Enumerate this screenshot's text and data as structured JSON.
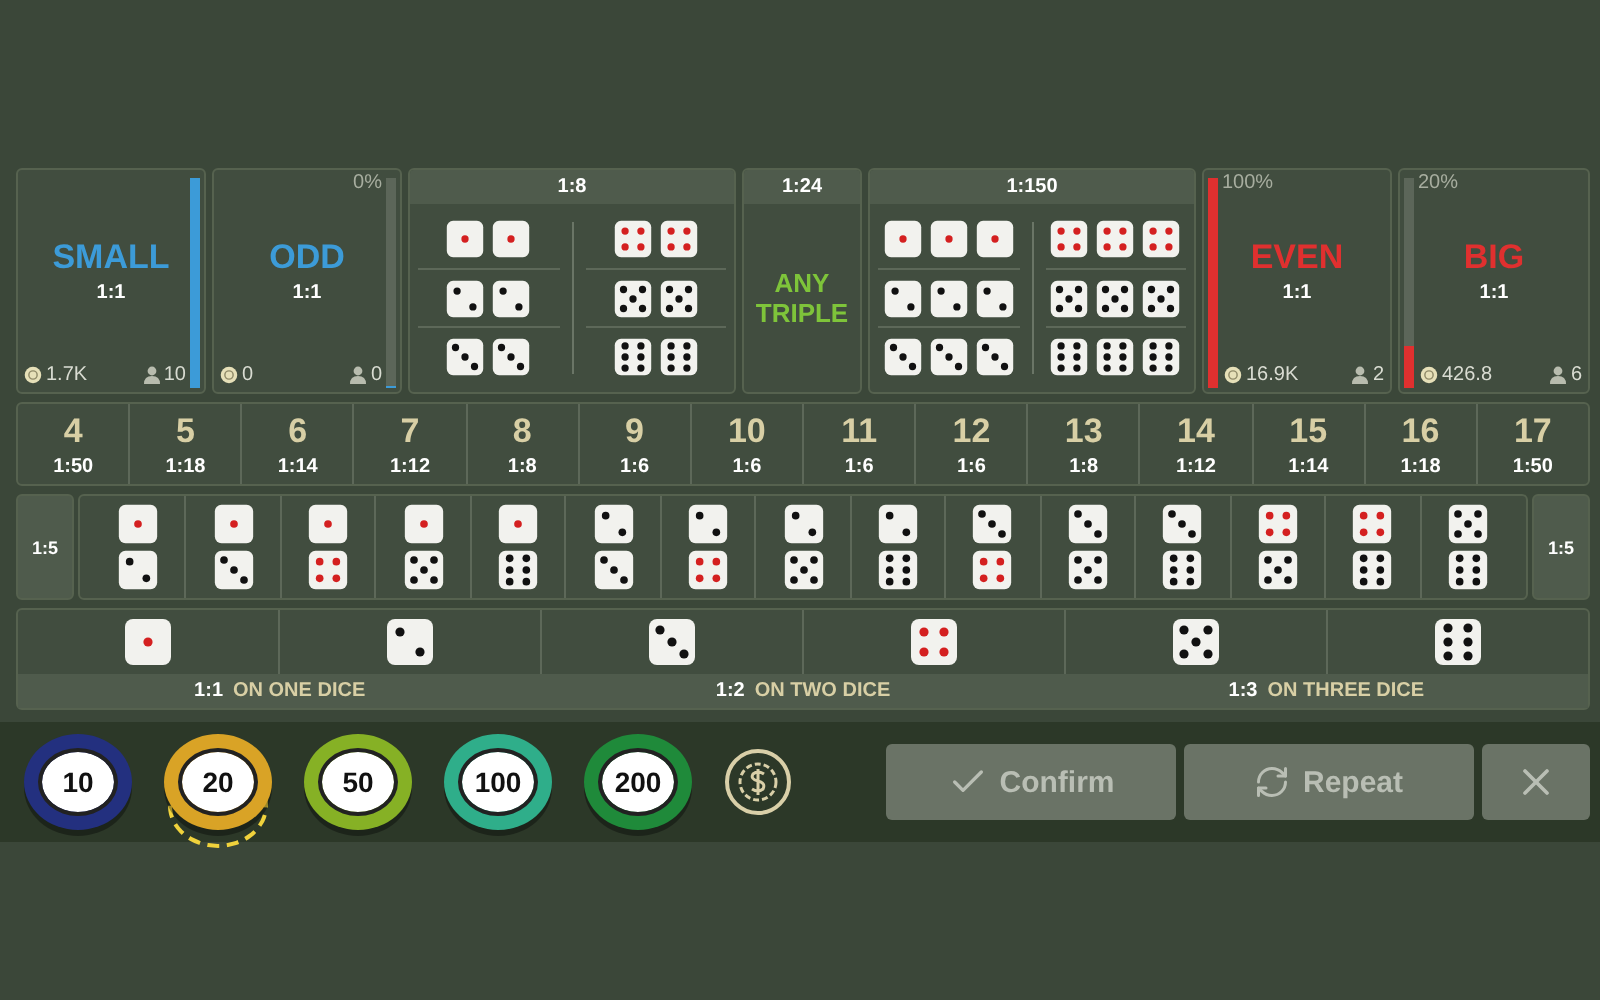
{
  "side_bets": [
    {
      "label": "SMALL",
      "ratio": "1:1",
      "color": "#3c9bd8",
      "level": 1,
      "chips": "1.7K",
      "players": "10"
    },
    {
      "label": "ODD",
      "ratio": "1:1",
      "color": "#3c9bd8",
      "percent": "0%",
      "level": 0,
      "chips": "0",
      "players": "0"
    },
    {
      "label": "EVEN",
      "ratio": "1:1",
      "color": "#e0302f",
      "percent": "100%",
      "level": 1,
      "chips": "16.9K",
      "players": "2"
    },
    {
      "label": "BIG",
      "ratio": "1:1",
      "color": "#e0302f",
      "percent": "20%",
      "level": 0.2,
      "chips": "426.8",
      "players": "6"
    }
  ],
  "doubles": {
    "ratio": "1:8",
    "columns": [
      [
        [
          {
            "kind": "one"
          },
          {
            "kind": "one"
          }
        ],
        [
          {
            "kind": "two"
          },
          {
            "kind": "two"
          }
        ],
        [
          {
            "kind": "three"
          },
          {
            "kind": "three"
          }
        ]
      ],
      [
        [
          {
            "kind": "four"
          },
          {
            "kind": "four"
          }
        ],
        [
          {
            "kind": "five"
          },
          {
            "kind": "five"
          }
        ],
        [
          {
            "kind": "six"
          },
          {
            "kind": "six"
          }
        ]
      ]
    ]
  },
  "any_triple": {
    "ratio": "1:24",
    "label": "ANY TRIPLE"
  },
  "triples": {
    "ratio": "1:150",
    "columns": [
      [
        [
          {
            "kind": "one"
          },
          {
            "kind": "one"
          },
          {
            "kind": "one"
          }
        ],
        [
          {
            "kind": "two"
          },
          {
            "kind": "two"
          },
          {
            "kind": "two"
          }
        ],
        [
          {
            "kind": "three"
          },
          {
            "kind": "three"
          },
          {
            "kind": "three"
          }
        ]
      ],
      [
        [
          {
            "kind": "four"
          },
          {
            "kind": "four"
          },
          {
            "kind": "four"
          }
        ],
        [
          {
            "kind": "five"
          },
          {
            "kind": "five"
          },
          {
            "kind": "five"
          }
        ],
        [
          {
            "kind": "six"
          },
          {
            "kind": "six"
          },
          {
            "kind": "six"
          }
        ]
      ]
    ]
  },
  "totals": [
    {
      "total": "4",
      "ratio": "1:50"
    },
    {
      "total": "5",
      "ratio": "1:18"
    },
    {
      "total": "6",
      "ratio": "1:14"
    },
    {
      "total": "7",
      "ratio": "1:12"
    },
    {
      "total": "8",
      "ratio": "1:8"
    },
    {
      "total": "9",
      "ratio": "1:6"
    },
    {
      "total": "10",
      "ratio": "1:6"
    },
    {
      "total": "11",
      "ratio": "1:6"
    },
    {
      "total": "12",
      "ratio": "1:6"
    },
    {
      "total": "13",
      "ratio": "1:8"
    },
    {
      "total": "14",
      "ratio": "1:12"
    },
    {
      "total": "15",
      "ratio": "1:14"
    },
    {
      "total": "16",
      "ratio": "1:18"
    },
    {
      "total": "17",
      "ratio": "1:50"
    }
  ],
  "combinations": {
    "ratio_left": "1:5",
    "ratio_right": "1:5",
    "pairs": [
      [
        {
          "kind": "one"
        },
        {
          "kind": "two"
        }
      ],
      [
        {
          "kind": "one"
        },
        {
          "kind": "three"
        }
      ],
      [
        {
          "kind": "one"
        },
        {
          "kind": "four"
        }
      ],
      [
        {
          "kind": "one"
        },
        {
          "kind": "five"
        }
      ],
      [
        {
          "kind": "one"
        },
        {
          "kind": "six"
        }
      ],
      [
        {
          "kind": "two"
        },
        {
          "kind": "three"
        }
      ],
      [
        {
          "kind": "two"
        },
        {
          "kind": "four"
        }
      ],
      [
        {
          "kind": "two"
        },
        {
          "kind": "five"
        }
      ],
      [
        {
          "kind": "two"
        },
        {
          "kind": "six"
        }
      ],
      [
        {
          "kind": "three"
        },
        {
          "kind": "four"
        }
      ],
      [
        {
          "kind": "three"
        },
        {
          "kind": "five"
        }
      ],
      [
        {
          "kind": "three"
        },
        {
          "kind": "six"
        }
      ],
      [
        {
          "kind": "four"
        },
        {
          "kind": "five"
        }
      ],
      [
        {
          "kind": "four"
        },
        {
          "kind": "six"
        }
      ],
      [
        {
          "kind": "five"
        },
        {
          "kind": "six"
        }
      ]
    ]
  },
  "singles": {
    "faces": [
      {
        "kind": "one"
      },
      {
        "kind": "two"
      },
      {
        "kind": "three"
      },
      {
        "kind": "four"
      },
      {
        "kind": "five"
      },
      {
        "kind": "six"
      }
    ],
    "payouts": [
      {
        "ratio": "1:1",
        "label": "ON ONE DICE"
      },
      {
        "ratio": "1:2",
        "label": "ON TWO DICE"
      },
      {
        "ratio": "1:3",
        "label": "ON THREE DICE"
      }
    ]
  },
  "chips": [
    {
      "value": "10",
      "color": "#23307f",
      "selected": false
    },
    {
      "value": "20",
      "color": "#d9a326",
      "selected": true
    },
    {
      "value": "50",
      "color": "#86b125",
      "selected": false
    },
    {
      "value": "100",
      "color": "#2fae8a",
      "selected": false
    },
    {
      "value": "200",
      "color": "#1f8a3a",
      "selected": false
    }
  ],
  "buttons": {
    "confirm": "Confirm",
    "repeat": "Repeat"
  }
}
